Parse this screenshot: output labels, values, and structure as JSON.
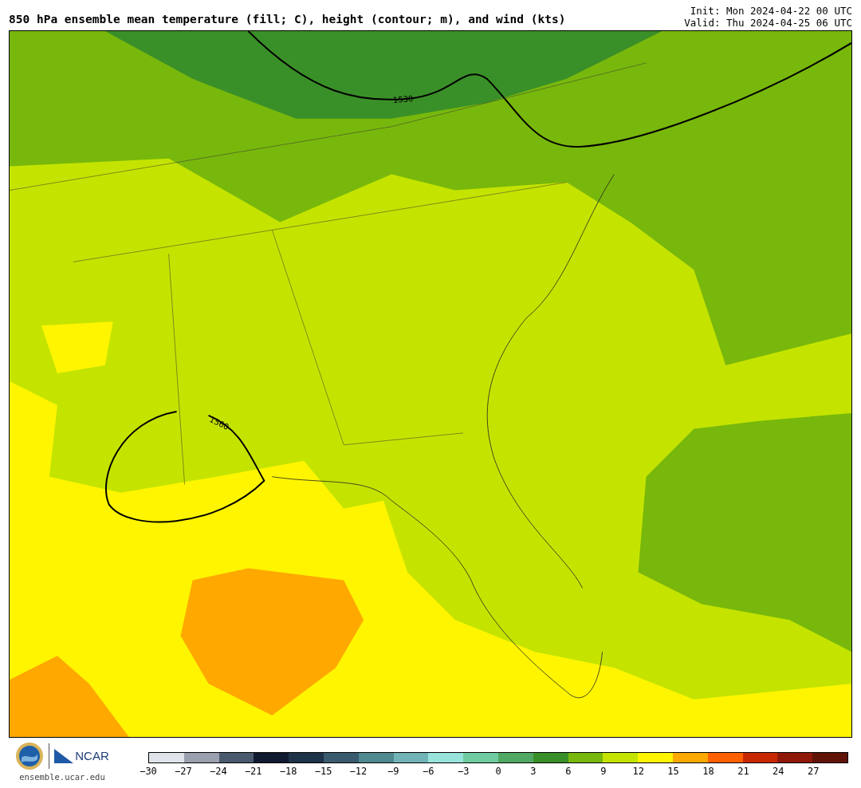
{
  "title": "850 hPa ensemble mean temperature (fill; C), height (contour; m), and wind (kts)",
  "init": "Init: Mon 2024-04-22 00 UTC",
  "valid": "Valid: Thu 2024-04-25 06 UTC",
  "map": {
    "contour_labels": [
      "1530",
      "1560"
    ]
  },
  "footer": {
    "logo_text": "NCAR",
    "site": "ensemble.ucar.edu"
  },
  "colorbar": [
    {
      "color": "#e0e4ea",
      "tick": "−30"
    },
    {
      "color": "#9aa0ae",
      "tick": "−27"
    },
    {
      "color": "#4a5a6e",
      "tick": "−24"
    },
    {
      "color": "#101a30",
      "tick": "−21"
    },
    {
      "color": "#1e3248",
      "tick": "−18"
    },
    {
      "color": "#3a5a6e",
      "tick": "−15"
    },
    {
      "color": "#508890",
      "tick": "−12"
    },
    {
      "color": "#70b4b8",
      "tick": "−9"
    },
    {
      "color": "#98e4dc",
      "tick": "−6"
    },
    {
      "color": "#70cca0",
      "tick": "−3"
    },
    {
      "color": "#50a864",
      "tick": "0"
    },
    {
      "color": "#3a9028",
      "tick": "3"
    },
    {
      "color": "#78b80c",
      "tick": "6"
    },
    {
      "color": "#c4e400",
      "tick": "9"
    },
    {
      "color": "#fff500",
      "tick": "12"
    },
    {
      "color": "#ffa800",
      "tick": "15"
    },
    {
      "color": "#ff6000",
      "tick": "18"
    },
    {
      "color": "#c82800",
      "tick": "21"
    },
    {
      "color": "#901808",
      "tick": "24"
    },
    {
      "color": "#601408",
      "tick": "27"
    }
  ]
}
